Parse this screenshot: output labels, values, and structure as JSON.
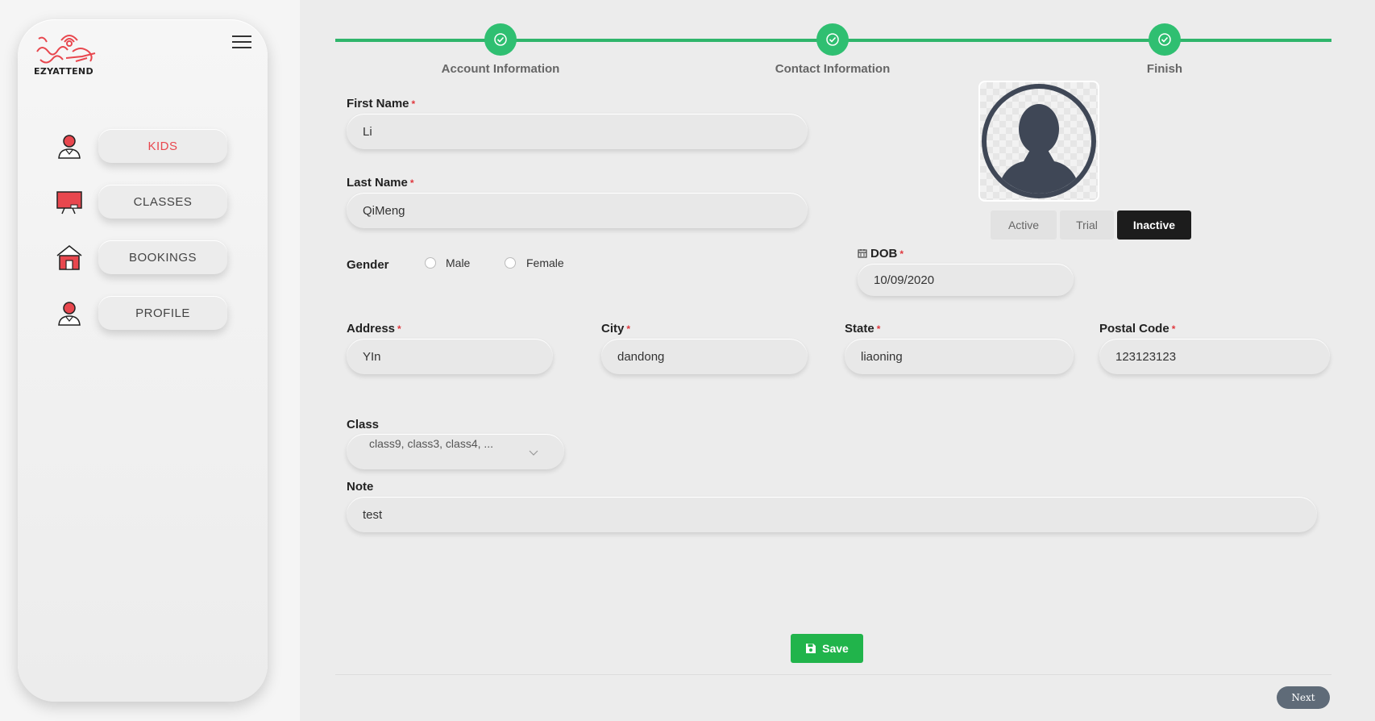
{
  "brand": {
    "name": "EZYATTEND",
    "accent": "#e8474e"
  },
  "sidebar": {
    "items": [
      {
        "label": "KIDS",
        "icon": "kid-icon",
        "active": true
      },
      {
        "label": "CLASSES",
        "icon": "classroom-board-icon",
        "active": false
      },
      {
        "label": "BOOKINGS",
        "icon": "house-icon",
        "active": false
      },
      {
        "label": "PROFILE",
        "icon": "person-icon",
        "active": false
      }
    ]
  },
  "steps": [
    {
      "label": "Account Information",
      "done": true
    },
    {
      "label": "Contact Information",
      "done": true
    },
    {
      "label": "Finish",
      "done": true
    }
  ],
  "form": {
    "first_name": {
      "label": "First Name",
      "required": "*",
      "value": "Li"
    },
    "last_name": {
      "label": "Last Name",
      "required": "*",
      "value": "QiMeng"
    },
    "gender": {
      "label": "Gender",
      "options": [
        "Male",
        "Female"
      ]
    },
    "dob": {
      "label": "DOB",
      "required": "*",
      "value": "10/09/2020"
    },
    "address": {
      "label": "Address",
      "required": "*",
      "value": "YIn"
    },
    "city": {
      "label": "City",
      "required": "*",
      "value": "dandong"
    },
    "state": {
      "label": "State",
      "required": "*",
      "value": "liaoning"
    },
    "postal_code": {
      "label": "Postal Code",
      "required": "*",
      "value": "123123123"
    },
    "class": {
      "label": "Class",
      "value": "class9, class3, class4, ..."
    },
    "note": {
      "label": "Note",
      "value": "test"
    }
  },
  "status": {
    "options": [
      "Active",
      "Trial",
      "Inactive"
    ],
    "selected": "Inactive"
  },
  "actions": {
    "save_label": "Save",
    "next_label": "Next"
  }
}
